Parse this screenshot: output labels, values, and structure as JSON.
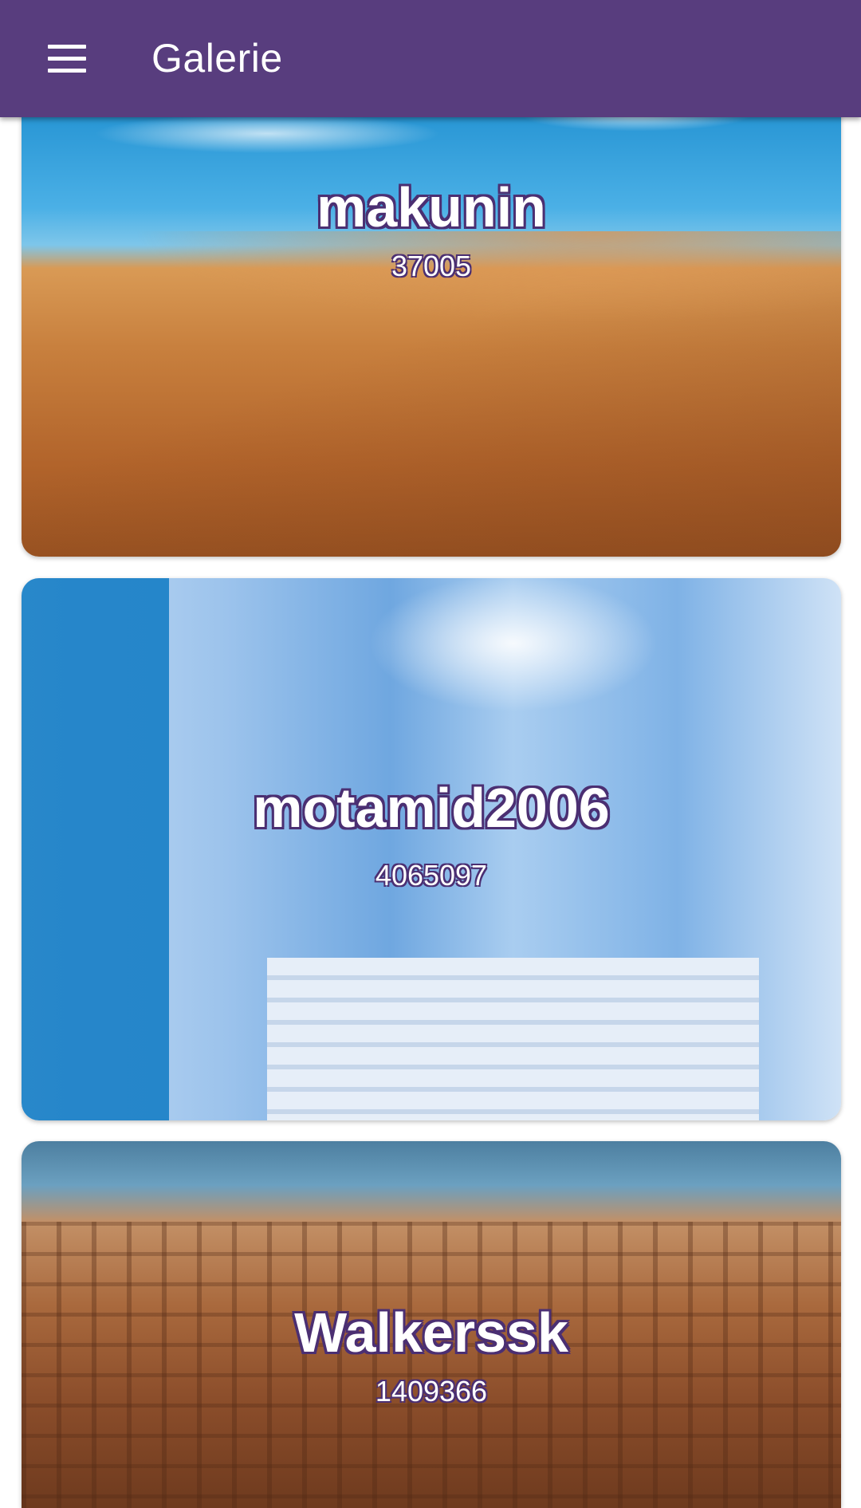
{
  "appbar": {
    "title": "Galerie",
    "menu_icon": "hamburger-menu-icon",
    "color": "#583d7e"
  },
  "gallery": {
    "items": [
      {
        "name": "makunin",
        "count": "37005",
        "scene": "desert dune"
      },
      {
        "name": "motamid2006",
        "count": "4065097",
        "scene": "blue city street"
      },
      {
        "name": "Walkerssk",
        "count": "1409366",
        "scene": "kasbah village"
      }
    ]
  },
  "colors": {
    "text_outline": "#4b2f72"
  }
}
